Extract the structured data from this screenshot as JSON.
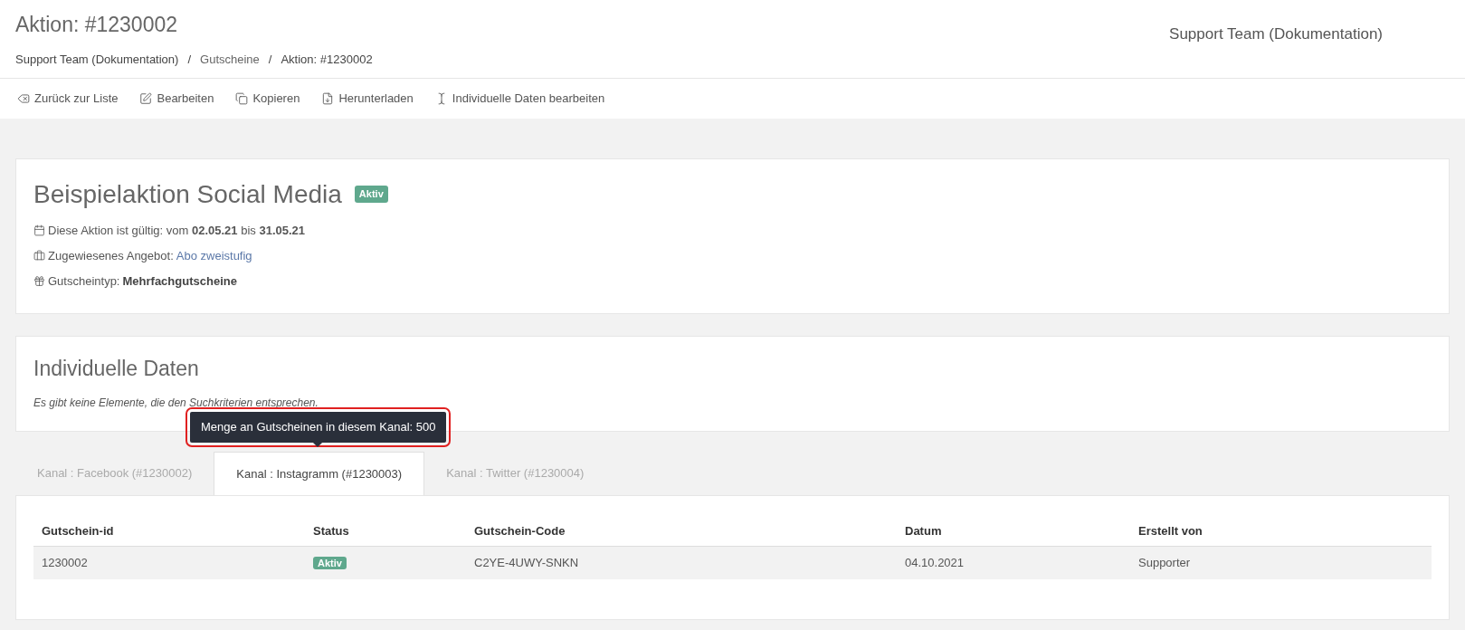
{
  "header": {
    "title": "Aktion: #1230002",
    "team": "Support Team (Dokumentation)",
    "breadcrumb": [
      "Support Team (Dokumentation)",
      "Gutscheine",
      "Aktion: #1230002"
    ],
    "separator": "/"
  },
  "toolbar": [
    {
      "kind": "back",
      "label": "Zurück zur Liste"
    },
    {
      "kind": "edit",
      "label": "Bearbeiten"
    },
    {
      "kind": "copy",
      "label": "Kopieren"
    },
    {
      "kind": "download",
      "label": "Herunterladen"
    },
    {
      "kind": "cursor",
      "label": "Individuelle Daten bearbeiten"
    }
  ],
  "campaign": {
    "title": "Beispielaktion Social Media",
    "badge": "Aktiv",
    "details": [
      {
        "kind": "calendar",
        "text": "Diese Aktion ist gültig: vom **02.05.21** bis **31.05.21**"
      },
      {
        "kind": "offer",
        "label": "Zugewiesenes Angebot:",
        "link": "Abo zweistufig"
      },
      {
        "kind": "gift",
        "label": "Gutscheintyp:",
        "value": "Mehrfachgutscheine"
      }
    ]
  },
  "individual_data": {
    "title": "Individuelle Daten",
    "empty_message": "Es gibt keine Elemente, die den Suchkriterien entsprechen."
  },
  "tooltip": "Menge an Gutscheinen in diesem Kanal: 500",
  "tabs": [
    {
      "label": "Kanal : Facebook (#1230002)",
      "selected": false
    },
    {
      "label": "Kanal : Instagramm (#1230003)",
      "selected": true
    },
    {
      "label": "Kanal : Twitter (#1230004)",
      "selected": false
    }
  ],
  "table": {
    "columns": [
      "Gutschein-id",
      "Status",
      "Gutschein-Code",
      "Datum",
      "Erstellt von"
    ],
    "rows": [
      {
        "id": "1230002",
        "status": "Aktiv",
        "code": "C2YE-4UWY-SNKN",
        "date": "04.10.2021",
        "created_by": "Supporter"
      }
    ]
  }
}
